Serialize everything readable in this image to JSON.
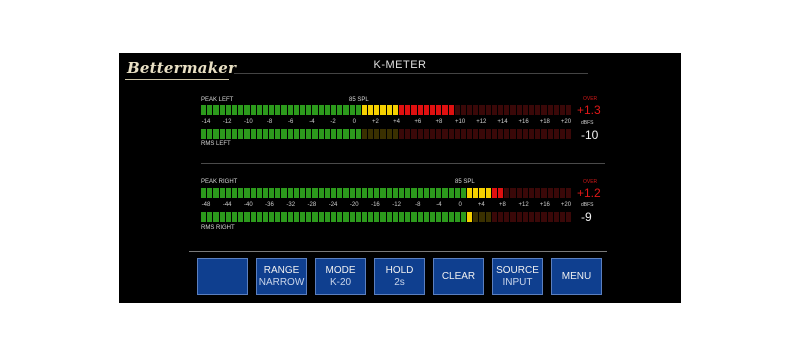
{
  "app": {
    "logo_text": "Bettermaker",
    "title": "K-METER"
  },
  "left": {
    "peak_label": "PEAK LEFT",
    "rms_label": "RMS LEFT",
    "ref_label": "85 SPL",
    "scale": [
      "-14",
      "-12",
      "-10",
      "-8",
      "-6",
      "-4",
      "-2",
      "0",
      "+2",
      "+4",
      "+6",
      "+8",
      "+10",
      "+12",
      "+14",
      "+16",
      "+18",
      "+20"
    ],
    "over_label": "OVER",
    "peak_value": "+1.3",
    "unit_label": "dBFS",
    "rms_value": "-10",
    "peak_level": 0.69,
    "rms_level": 0.43
  },
  "right": {
    "peak_label": "PEAK RIGHT",
    "rms_label": "RMS RIGHT",
    "ref_label": "85 SPL",
    "scale": [
      "-48",
      "-44",
      "-40",
      "-36",
      "-32",
      "-28",
      "-24",
      "-20",
      "-16",
      "-12",
      "-8",
      "-4",
      "0",
      "+4",
      "+8",
      "+12",
      "+16",
      "+20"
    ],
    "over_label": "OVER",
    "peak_value": "+1.2",
    "unit_label": "dBFS",
    "rms_value": "-9",
    "peak_level": 0.81,
    "rms_level": 0.73
  },
  "colors": {
    "green_on": "#2c9a1c",
    "green_off": "#0d3a0a",
    "yellow_on": "#f5d000",
    "yellow_off": "#3a3000",
    "red_on": "#e01010",
    "red_off": "#3a0808"
  },
  "buttons": [
    {
      "label": "",
      "sub": ""
    },
    {
      "label": "RANGE",
      "sub": "NARROW"
    },
    {
      "label": "MODE",
      "sub": "K-20"
    },
    {
      "label": "HOLD",
      "sub": "2s"
    },
    {
      "label": "CLEAR",
      "sub": ""
    },
    {
      "label": "SOURCE",
      "sub": "INPUT"
    },
    {
      "label": "MENU",
      "sub": ""
    }
  ]
}
